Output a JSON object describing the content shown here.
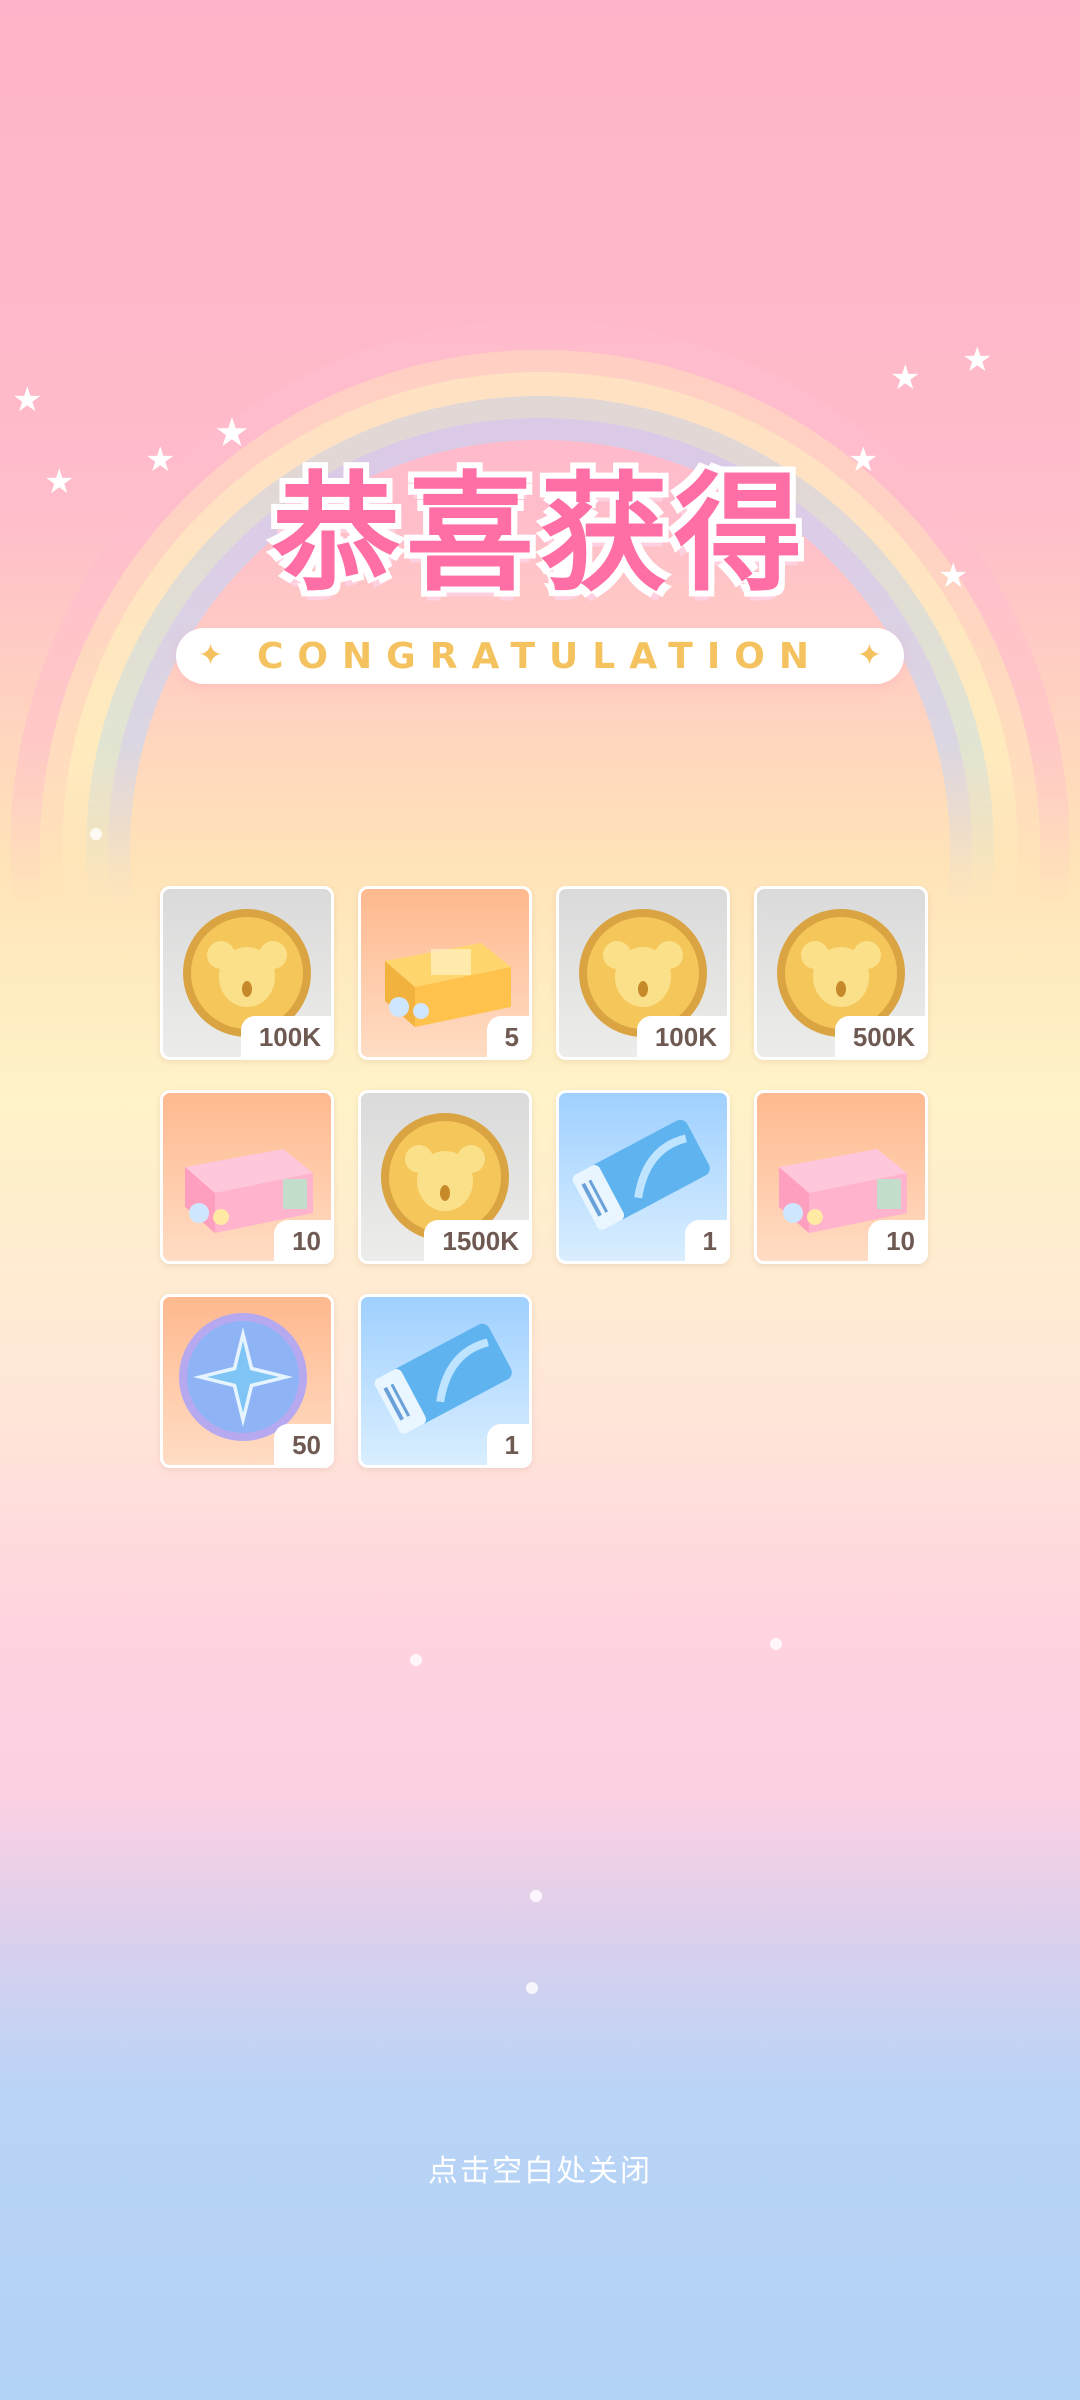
{
  "title": "恭喜获得",
  "subtitle": "CONGRATULATION",
  "rewards": [
    {
      "icon": "coin-icon",
      "count": "100K"
    },
    {
      "icon": "gift-box-orange-icon",
      "count": "5"
    },
    {
      "icon": "coin-icon",
      "count": "100K"
    },
    {
      "icon": "coin-icon",
      "count": "500K"
    },
    {
      "icon": "gift-box-pink-icon",
      "count": "10"
    },
    {
      "icon": "coin-icon",
      "count": "1500K"
    },
    {
      "icon": "ticket-icon",
      "count": "1"
    },
    {
      "icon": "gift-box-pink-icon",
      "count": "10"
    },
    {
      "icon": "star-medal-icon",
      "count": "50"
    },
    {
      "icon": "ticket-icon",
      "count": "1"
    }
  ],
  "close_hint": "点击空白处关闭",
  "colors": {
    "title_pink": "#ff6fa5",
    "subtitle_gold": "#f4c25e",
    "count_text": "#6e5a52"
  }
}
